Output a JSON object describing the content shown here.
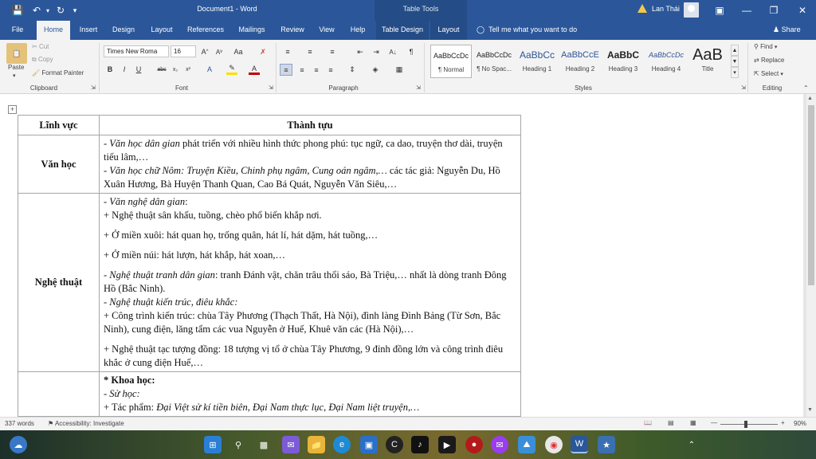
{
  "titlebar": {
    "doc_title": "Document1 - Word",
    "table_tools": "Table Tools",
    "user": "Lan Thái",
    "save_icon": "save-icon",
    "undo_icon": "undo-icon",
    "redo_icon": "redo-icon",
    "customize_icon": "customize-qat-icon"
  },
  "tabs": [
    "File",
    "Home",
    "Insert",
    "Design",
    "Layout",
    "References",
    "Mailings",
    "Review",
    "View",
    "Help",
    "Table Design",
    "Layout"
  ],
  "active_tab": "Home",
  "tell_me": "Tell me what you want to do",
  "share": "Share",
  "ribbon": {
    "clipboard": {
      "label": "Clipboard",
      "paste": "Paste",
      "cut": "Cut",
      "copy": "Copy",
      "format_painter": "Format Painter"
    },
    "font": {
      "label": "Font",
      "font_name": "Times New Roma",
      "font_size": "16"
    },
    "paragraph": {
      "label": "Paragraph"
    },
    "styles": {
      "label": "Styles",
      "items": [
        {
          "preview": "AaBbCcDc",
          "name": "¶ Normal"
        },
        {
          "preview": "AaBbCcDc",
          "name": "¶ No Spac..."
        },
        {
          "preview": "AaBbCc",
          "name": "Heading 1"
        },
        {
          "preview": "AaBbCcE",
          "name": "Heading 2"
        },
        {
          "preview": "AaBbC",
          "name": "Heading 3"
        },
        {
          "preview": "AaBbCcDc",
          "name": "Heading 4"
        },
        {
          "preview": "AaB",
          "name": "Title"
        }
      ]
    },
    "editing": {
      "label": "Editing",
      "find": "Find",
      "replace": "Replace",
      "select": "Select"
    }
  },
  "table": {
    "headers": [
      "Lĩnh vực",
      "Thành tựu"
    ],
    "rows": [
      {
        "field": "Văn học"
      },
      {
        "field": "Nghệ thuật"
      },
      {
        "field": ""
      }
    ],
    "r1": {
      "a1": "- Văn học dân gian",
      "a2": " phát triển với nhiều hình thức phong phú: tục ngữ, ca dao, truyện thơ dài, truyện tiếu lâm,…",
      "b1": "- Văn học chữ Nôm",
      "b2": ": Truyện Kiều, Chinh phụ ngâm, Cung oán ngâm,…",
      "b3": " các tác giả: Nguyễn Du, Hồ Xuân Hương, Bà Huyện Thanh Quan, Cao Bá Quát, Nguyễn Văn Siêu,…"
    },
    "r2": {
      "a": "- Văn nghệ dân gian",
      "a_colon": ":",
      "l1": "+ Nghệ thuật sân khấu, tuồng, chèo phổ biến khắp nơi.",
      "l2": "+ Ở miền xuôi: hát quan họ, trống quân, hát lí, hát dặm, hát tuồng,…",
      "l3": "+ Ở miền núi: hát lượn, hát khắp, hát xoan,…",
      "b1": "- Nghệ thuật tranh dân gian",
      "b2": ": tranh Đánh vật, chăn trâu thổi sáo, Bà Triệu,… nhất là dòng tranh Đông Hồ (Bắc Ninh).",
      "c_dash": "- ",
      "c": "Nghệ thuật kiến trúc, điêu khắc:",
      "l4": "+ Công trình kiến trúc: chùa Tây Phương (Thạch Thất, Hà Nội), đình làng Đình Bảng (Từ Sơn, Bắc Ninh), cung điện, lăng tẩm các vua Nguyễn ở Huế, Khuê văn các (Hà Nội),…",
      "l5": "+ Nghệ thuật tạc tượng đồng: 18 tượng vị tổ ở chùa Tây Phương, 9 đỉnh đồng lớn và công trình điêu khắc ở cung điện Huế,…"
    },
    "r3": {
      "a": "* Khoa học:",
      "b": "- Sử học:",
      "c1": "+ Tác phẩm: ",
      "c2": "Đại Việt sử kí tiền biên, Đại Nam thực lục, Đại Nam liệt truyện,…"
    }
  },
  "status": {
    "words": "337 words",
    "accessibility": "Accessibility: Investigate",
    "zoom": "90%"
  }
}
